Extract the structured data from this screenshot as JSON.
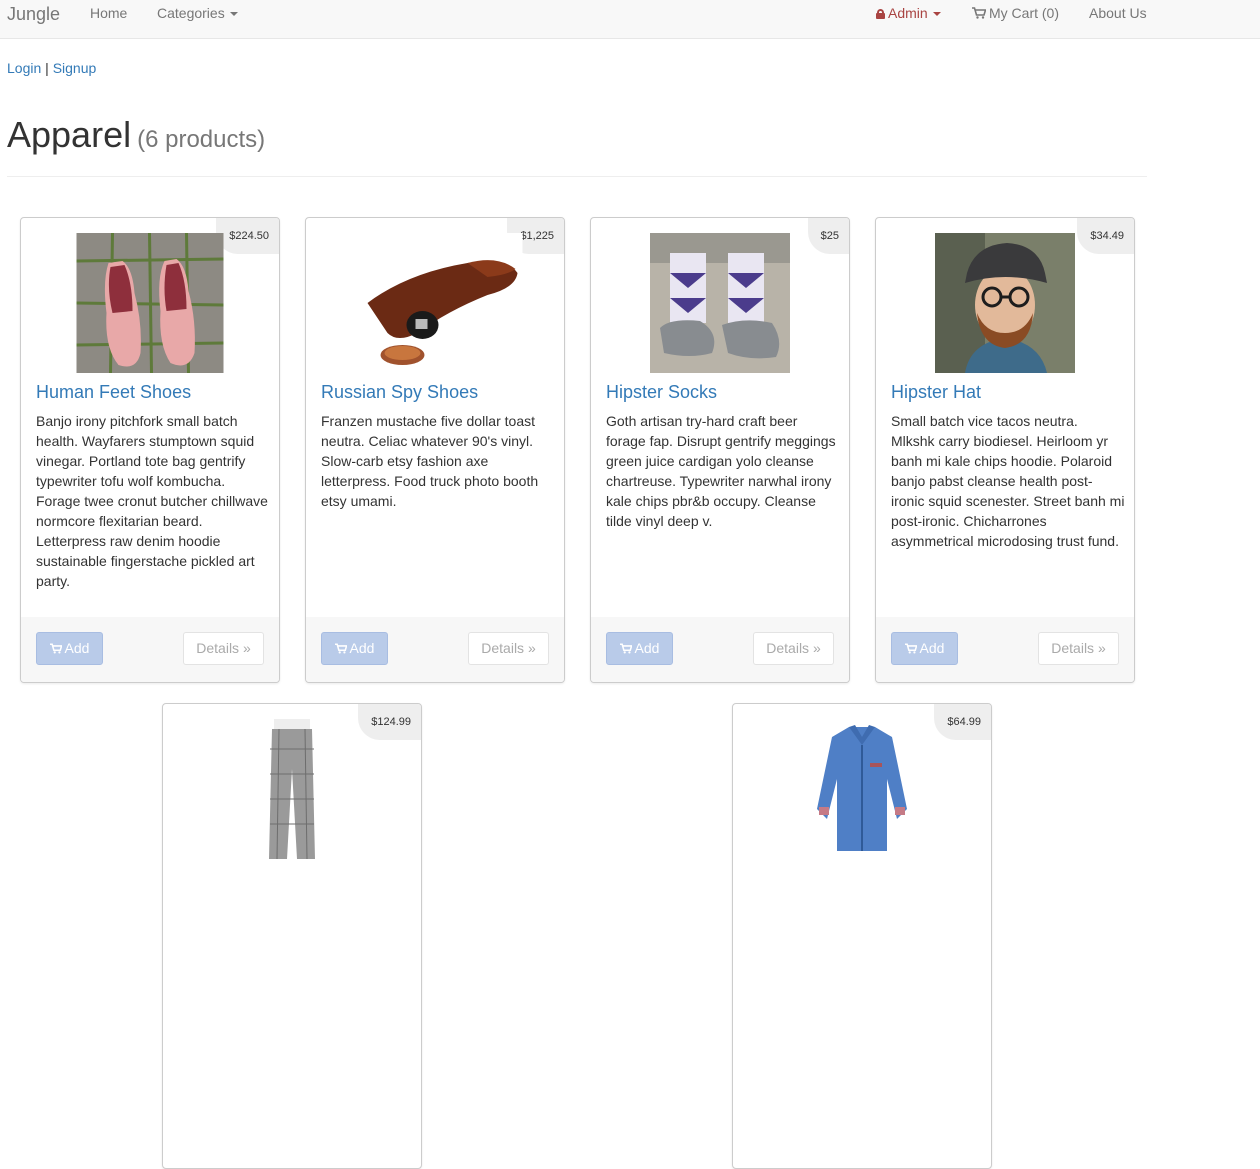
{
  "navbar": {
    "brand": "Jungle",
    "home": "Home",
    "categories": "Categories",
    "admin": "Admin",
    "cart": "My Cart (0)",
    "about": "About Us"
  },
  "auth": {
    "login": "Login",
    "separator": "|",
    "signup": "Signup"
  },
  "page": {
    "title": "Apparel",
    "count": "(6 products)"
  },
  "products": [
    {
      "name": "Human Feet Shoes",
      "price": "$224.50",
      "description": "Banjo irony pitchfork small batch health. Wayfarers stumptown squid vinegar. Portland tote bag gentrify typewriter tofu wolf kombucha. Forage twee cronut butcher chillwave normcore flexitarian beard. Letterpress raw denim hoodie sustainable fingerstache pickled art party.",
      "add_label": "Add",
      "details_label": "Details »"
    },
    {
      "name": "Russian Spy Shoes",
      "price": "$1,225",
      "description": "Franzen mustache five dollar toast neutra. Celiac whatever 90's vinyl. Slow-carb etsy fashion axe letterpress. Food truck photo booth etsy umami.",
      "add_label": "Add",
      "details_label": "Details »"
    },
    {
      "name": "Hipster Socks",
      "price": "$25",
      "description": "Goth artisan try-hard craft beer forage fap. Disrupt gentrify meggings green juice cardigan yolo cleanse chartreuse. Typewriter narwhal irony kale chips pbr&b occupy. Cleanse tilde vinyl deep v.",
      "add_label": "Add",
      "details_label": "Details »"
    },
    {
      "name": "Hipster Hat",
      "price": "$34.49",
      "description": "Small batch vice tacos neutra. Mlkshk carry biodiesel. Heirloom yr banh mi kale chips hoodie. Polaroid banjo pabst cleanse health post-ironic squid scenester. Street banh mi post-ironic. Chicharrones asymmetrical microdosing trust fund.",
      "add_label": "Add",
      "details_label": "Details »"
    },
    {
      "price": "$124.99"
    },
    {
      "price": "$64.99"
    }
  ]
}
